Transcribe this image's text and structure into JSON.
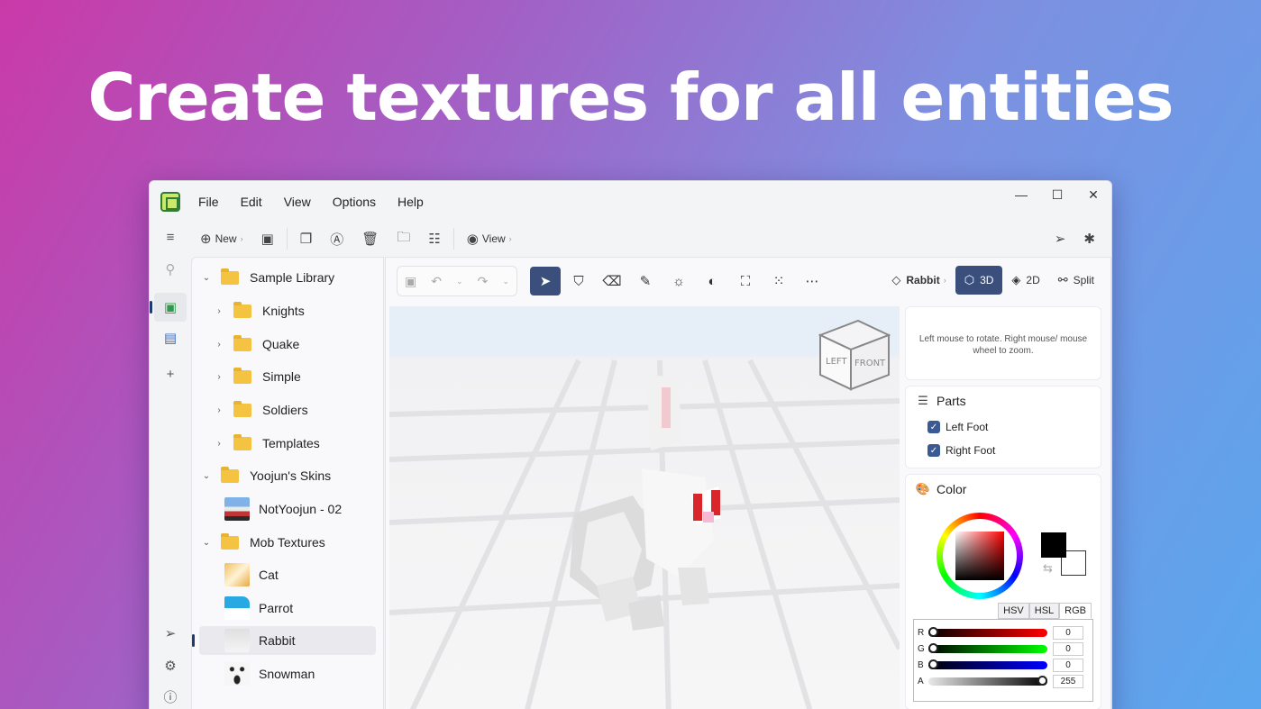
{
  "hero": {
    "title": "Create textures for all entities"
  },
  "menu": [
    "File",
    "Edit",
    "View",
    "Options",
    "Help"
  ],
  "toolbar": {
    "new_label": "New",
    "view_label": "View"
  },
  "tree": {
    "sample_library": "Sample Library",
    "sample_children": [
      "Knights",
      "Quake",
      "Simple",
      "Soldiers",
      "Templates"
    ],
    "yoojun_skins": "Yoojun's Skins",
    "yoojun_children": [
      "NotYoojun - 02"
    ],
    "mob_textures": "Mob Textures",
    "mob_children": [
      "Cat",
      "Parrot",
      "Rabbit",
      "Snowman"
    ]
  },
  "editor": {
    "model_name": "Rabbit",
    "mode_3d": "3D",
    "mode_2d": "2D",
    "mode_split": "Split",
    "viewcube_left": "LEFT",
    "viewcube_front": "FRONT"
  },
  "hint": "Left mouse to rotate. Right mouse/ mouse wheel to zoom.",
  "parts": {
    "title": "Parts",
    "items": [
      "Left Foot",
      "Right Foot"
    ]
  },
  "color": {
    "title": "Color",
    "tabs": [
      "HSV",
      "HSL",
      "RGB"
    ],
    "sliders": [
      {
        "label": "R",
        "value": "0"
      },
      {
        "label": "G",
        "value": "0"
      },
      {
        "label": "B",
        "value": "0"
      },
      {
        "label": "A",
        "value": "255"
      }
    ],
    "primary": "#000000",
    "secondary": "#ffffff",
    "accent": "#3b4f7d"
  }
}
